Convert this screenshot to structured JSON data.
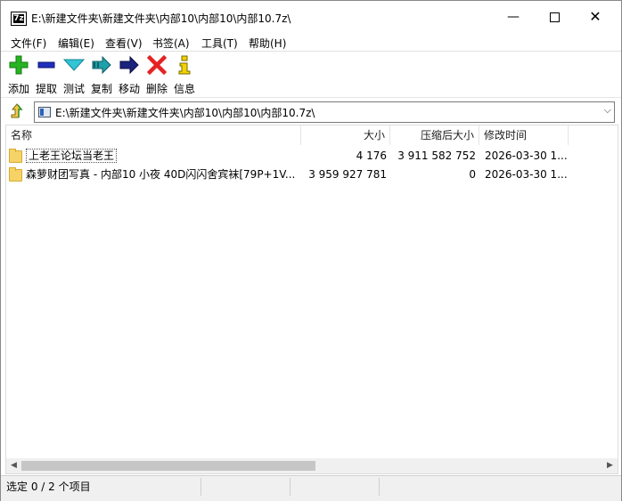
{
  "app": {
    "icon_text": "7z",
    "title": "E:\\新建文件夹\\新建文件夹\\内部10\\内部10\\内部10.7z\\"
  },
  "window_controls": {
    "minimize": "—",
    "close": "✕"
  },
  "menu": [
    {
      "label": "文件(F)"
    },
    {
      "label": "编辑(E)"
    },
    {
      "label": "查看(V)"
    },
    {
      "label": "书签(A)"
    },
    {
      "label": "工具(T)"
    },
    {
      "label": "帮助(H)"
    }
  ],
  "toolbar": [
    {
      "label": "添加",
      "icon": "add-icon",
      "color": "#27b323"
    },
    {
      "label": "提取",
      "icon": "extract-icon",
      "color": "#1f2fbd"
    },
    {
      "label": "测试",
      "icon": "test-icon",
      "color": "#33c4d6"
    },
    {
      "label": "复制",
      "icon": "copy-icon",
      "color": "#20a0a8"
    },
    {
      "label": "移动",
      "icon": "move-icon",
      "color": "#1a237e"
    },
    {
      "label": "删除",
      "icon": "delete-icon",
      "color": "#e52222"
    },
    {
      "label": "信息",
      "icon": "info-icon",
      "color": "#e0c400"
    }
  ],
  "address": {
    "path": "E:\\新建文件夹\\新建文件夹\\内部10\\内部10\\内部10.7z\\"
  },
  "columns": {
    "name": "名称",
    "size": "大小",
    "packed": "压缩后大小",
    "modified": "修改时间"
  },
  "rows": [
    {
      "name": "上老王论坛当老王",
      "size": "4 176",
      "packed": "3 911 582 752",
      "modified": "2026-03-30 1..."
    },
    {
      "name": "森萝财团写真 - 内部10 小夜 40D闪闪舍宾袜[79P+1V...",
      "size": "3 959 927 781",
      "packed": "0",
      "modified": "2026-03-30 1..."
    }
  ],
  "status": {
    "selection": "选定 0 / 2 个项目"
  }
}
